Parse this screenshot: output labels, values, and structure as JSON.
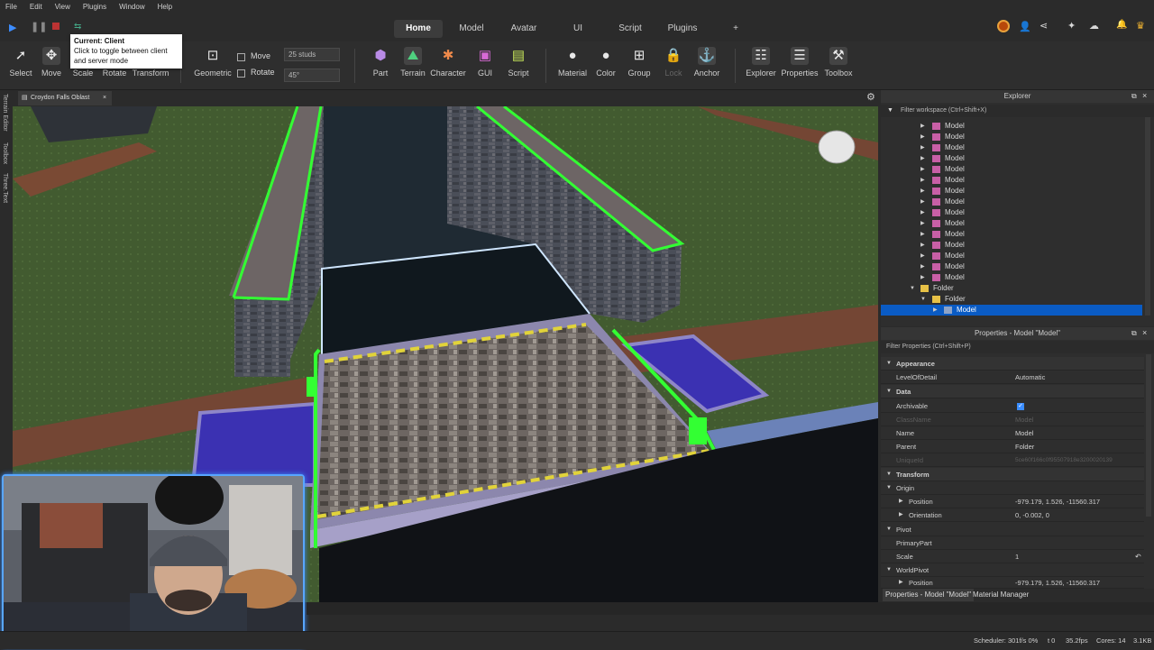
{
  "menu": [
    "File",
    "Edit",
    "View",
    "Plugins",
    "Window",
    "Help"
  ],
  "tabs": [
    "Home",
    "Model",
    "Avatar",
    "UI",
    "Script",
    "Plugins",
    "+"
  ],
  "tooltip": {
    "title": "Current: Client",
    "body": "Click to toggle between client and server mode"
  },
  "tools": {
    "select": "Select",
    "move": "Move",
    "scale": "Scale",
    "rotate": "Rotate",
    "transform": "Transform",
    "geometric": "Geometric",
    "move_snap": "Move",
    "rotate_snap": "Rotate",
    "move_value": "25 studs",
    "rotate_value": "45°",
    "part": "Part",
    "terrain": "Terrain",
    "character": "Character",
    "gui": "GUI",
    "script": "Script",
    "material": "Material",
    "color": "Color",
    "group": "Group",
    "lock": "Lock",
    "anchor": "Anchor",
    "explorer": "Explorer",
    "properties": "Properties",
    "toolbox": "Toolbox"
  },
  "left_strip": [
    "Terrain Editor",
    "Toolbox",
    "Three.Text"
  ],
  "doc_tab": "Croydon Falls Oblast",
  "explorer": {
    "title": "Explorer",
    "filter": "Filter workspace (Ctrl+Shift+X)",
    "items": [
      {
        "label": "Model"
      },
      {
        "label": "Model"
      },
      {
        "label": "Model"
      },
      {
        "label": "Model"
      },
      {
        "label": "Model"
      },
      {
        "label": "Model"
      },
      {
        "label": "Model"
      },
      {
        "label": "Model"
      },
      {
        "label": "Model"
      },
      {
        "label": "Model"
      },
      {
        "label": "Model"
      },
      {
        "label": "Model"
      },
      {
        "label": "Model"
      },
      {
        "label": "Model"
      },
      {
        "label": "Model"
      }
    ],
    "folder1": "Folder",
    "folder2": "Folder",
    "selected": "Model"
  },
  "properties": {
    "title": "Properties - Model \"Model\"",
    "filter": "Filter Properties (Ctrl+Shift+P)",
    "appearance": "Appearance",
    "lod_key": "LevelOfDetail",
    "lod_val": "Automatic",
    "data": "Data",
    "archivable": "Archivable",
    "classname_key": "ClassName",
    "classname_val": "Model",
    "name_key": "Name",
    "name_val": "Model",
    "parent_key": "Parent",
    "parent_val": "Folder",
    "uniqueid_key": "UniqueId",
    "uniqueid_val": "5ce60f166c0f95507918e3200020139",
    "transform": "Transform",
    "origin": "Origin",
    "position_key": "Position",
    "position_val": "-979.179, 1.526, -11560.317",
    "orientation_key": "Orientation",
    "orientation_val": "0, -0.002, 0",
    "pivot": "Pivot",
    "primarypart": "PrimaryPart",
    "scale_key": "Scale",
    "scale_val": "1",
    "worldpivot": "WorldPivot",
    "wp_position_key": "Position",
    "wp_position_val": "-979.179, 1.526, -11560.317"
  },
  "bottom_tabs": [
    "Properties - Model \"Model\"",
    "Material Manager"
  ],
  "status": {
    "scheduler": "Scheduler: 301f/s 0%",
    "t": "t 0",
    "fps": "35.2fps",
    "cores": "Cores: 14",
    "kb": "3.1KB"
  },
  "colors": {
    "accent": "#0a5bc4",
    "selection_green": "#33ff33",
    "tab_active": "#3c3c3c"
  }
}
